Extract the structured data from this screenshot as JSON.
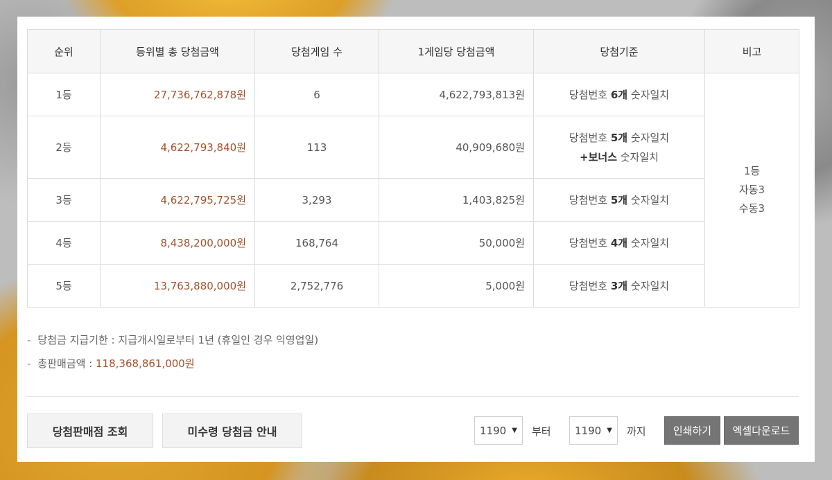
{
  "table": {
    "headers": [
      "순위",
      "등위별 총 당첨금액",
      "당첨게임 수",
      "1게임당 당첨금액",
      "당첨기준",
      "비고"
    ],
    "rows": [
      {
        "rank": "1등",
        "total": "27,736,762,878원",
        "count": "6",
        "per_game": "4,622,793,813원",
        "crit_prefix": "당첨번호 ",
        "crit_bold": "6개",
        "crit_suffix": " 숫자일치"
      },
      {
        "rank": "2등",
        "total": "4,622,793,840원",
        "count": "113",
        "per_game": "40,909,680원",
        "crit_prefix": "당첨번호 ",
        "crit_bold": "5개",
        "crit_suffix": " 숫자일치",
        "crit2_bold": "+보너스",
        "crit2_suffix": " 숫자일치"
      },
      {
        "rank": "3등",
        "total": "4,622,795,725원",
        "count": "3,293",
        "per_game": "1,403,825원",
        "crit_prefix": "당첨번호 ",
        "crit_bold": "5개",
        "crit_suffix": " 숫자일치"
      },
      {
        "rank": "4등",
        "total": "8,438,200,000원",
        "count": "168,764",
        "per_game": "50,000원",
        "crit_prefix": "당첨번호 ",
        "crit_bold": "4개",
        "crit_suffix": " 숫자일치"
      },
      {
        "rank": "5등",
        "total": "13,763,880,000원",
        "count": "2,752,776",
        "per_game": "5,000원",
        "crit_prefix": "당첨번호 ",
        "crit_bold": "3개",
        "crit_suffix": " 숫자일치"
      }
    ],
    "note": [
      "1등",
      "자동3",
      "수동3"
    ]
  },
  "info": {
    "dash": "-",
    "deadline_label": "당첨금 지급기한 : ",
    "deadline_value": "지급개시일로부터 1년 (휴일인 경우 익영업일)",
    "sales_label": "총판매금액 : ",
    "sales_value": "118,368,861,000원"
  },
  "actions": {
    "store_lookup": "당첨판매점 조회",
    "unclaimed": "미수령 당첨금 안내",
    "from_round": "1190",
    "from_label": "부터",
    "to_round": "1190",
    "to_label": "까지",
    "print": "인쇄하기",
    "excel": "엑셀다운로드",
    "caret": "▼"
  },
  "colors": {
    "accent_amount": "#a0522d",
    "button_dark": "#757575"
  }
}
